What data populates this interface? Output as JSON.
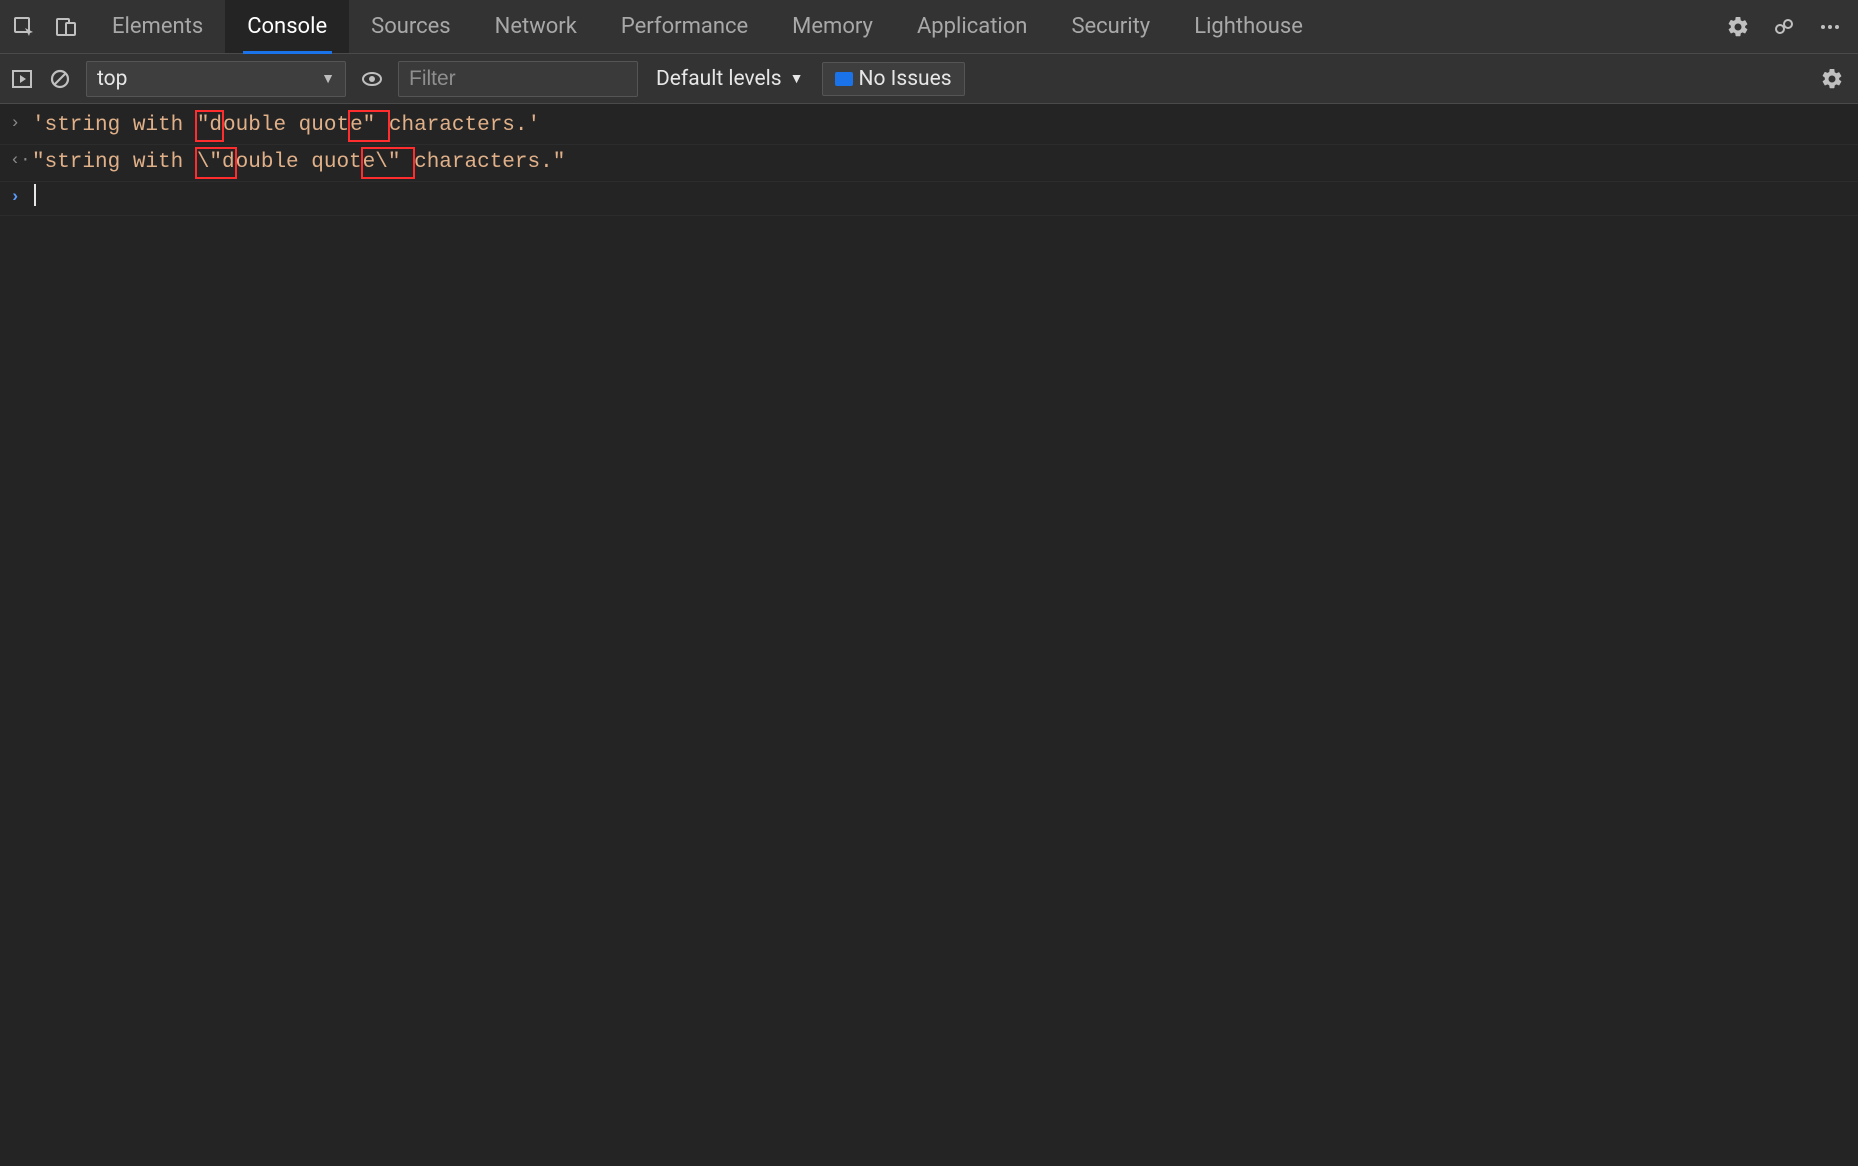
{
  "tabs": {
    "items": [
      {
        "label": "Elements"
      },
      {
        "label": "Console"
      },
      {
        "label": "Sources"
      },
      {
        "label": "Network"
      },
      {
        "label": "Performance"
      },
      {
        "label": "Memory"
      },
      {
        "label": "Application"
      },
      {
        "label": "Security"
      },
      {
        "label": "Lighthouse"
      }
    ],
    "active_index": 1
  },
  "toolbar": {
    "context_selected": "top",
    "filter_placeholder": "Filter",
    "levels_label": "Default levels",
    "issues_label": "No Issues"
  },
  "console": {
    "rows": [
      {
        "kind": "input",
        "gutter": "›",
        "segments": [
          {
            "t": "'string with ",
            "hl": false
          },
          {
            "t": "\"d",
            "hl": true
          },
          {
            "t": "ouble quot",
            "hl": false
          },
          {
            "t": "e\" ",
            "hl": true
          },
          {
            "t": "characters.'",
            "hl": false
          }
        ]
      },
      {
        "kind": "output",
        "gutter": "‹·",
        "segments": [
          {
            "t": "\"string with ",
            "hl": false
          },
          {
            "t": "\\\"d",
            "hl": true
          },
          {
            "t": "ouble quot",
            "hl": false
          },
          {
            "t": "e\\\" ",
            "hl": true
          },
          {
            "t": "characters.\"",
            "hl": false
          }
        ]
      },
      {
        "kind": "prompt",
        "gutter": "›",
        "segments": []
      }
    ]
  },
  "colors": {
    "accent": "#1a73e8",
    "highlight_border": "#ff2d2d",
    "string_color": "#e0b089"
  }
}
